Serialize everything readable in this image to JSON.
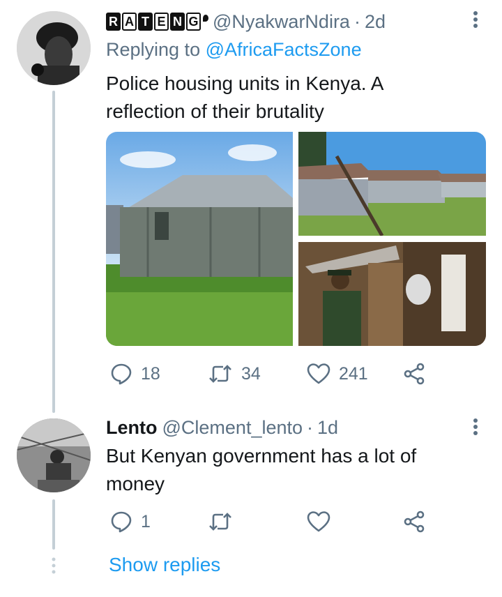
{
  "tweet": {
    "brand_letters": [
      "R",
      "A",
      "T",
      "E",
      "N",
      "G"
    ],
    "handle": "@NyakwarNdira",
    "separator": "·",
    "time": "2d",
    "replying_label": "Replying to",
    "replying_handle": "@AfricaFactsZone",
    "text_line1": "Police housing units in Kenya. A",
    "text_line2": "reflection of their brutality",
    "actions": {
      "replies": "18",
      "retweets": "34",
      "likes": "241"
    }
  },
  "reply": {
    "name": "Lento",
    "handle": "@Clement_lento",
    "separator": "·",
    "time": "1d",
    "text_line1": "But Kenyan government has a lot of",
    "text_line2": "money",
    "actions": {
      "replies": "1"
    }
  },
  "show_replies": "Show replies",
  "icons": {
    "more": "more-vertical-icon",
    "reply": "reply-bubble-icon",
    "retweet": "retweet-icon",
    "like": "heart-icon",
    "share": "share-icon"
  },
  "colors": {
    "accent": "#1d9bf0",
    "muted": "#5b7083",
    "thread": "#c4cfd6"
  }
}
